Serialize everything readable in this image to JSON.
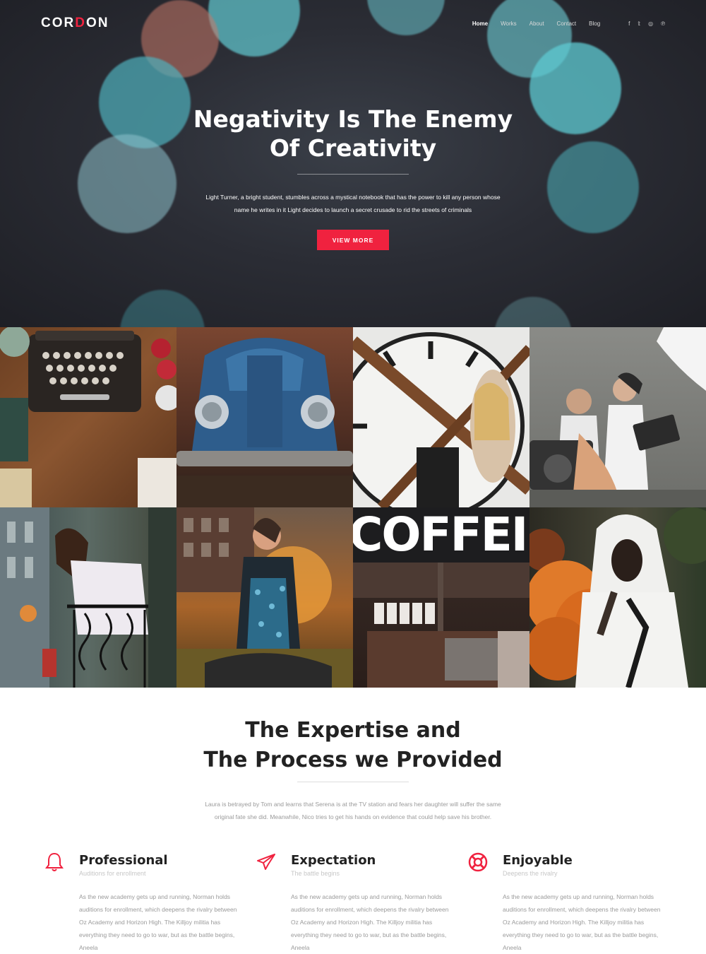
{
  "header": {
    "logo_left": "COR",
    "logo_mid": "D",
    "logo_right": "ON",
    "menu": [
      "Home",
      "Works",
      "About",
      "Contact",
      "Blog"
    ],
    "social": [
      "f",
      "𝕥",
      "◎",
      "℗"
    ]
  },
  "hero": {
    "title_line1": "Negativity Is The Enemy",
    "title_line2": "Of Creativity",
    "text": "Light Turner, a bright student, stumbles across a mystical notebook that has the power to kill any person whose name he writes in it Light decides to launch a secret crusade to rid the streets of criminals",
    "button": "VIEW MORE"
  },
  "gallery": {
    "coffee_sign": "COFFEI"
  },
  "expertise": {
    "title_line1": "The Expertise and",
    "title_line2": "The Process we Provided",
    "text": "Laura is betrayed by Tom and learns that Serena is at the TV station and fears her daughter will suffer the same original fate she did. Meanwhile, Nico tries to get his hands on evidence that could help save his brother.",
    "features": [
      {
        "icon": "bell-icon",
        "title": "Professional",
        "subtitle": "Auditions for enrollment",
        "body": "As the new academy gets up and running, Norman holds auditions for enrollment, which deepens the rivalry between Oz Academy and Horizon High. The Killjoy militia has everything they need to go to war, but as the battle begins, Aneela"
      },
      {
        "icon": "paper-plane-icon",
        "title": "Expectation",
        "subtitle": "The battle begins",
        "body": "As the new academy gets up and running, Norman holds auditions for enrollment, which deepens the rivalry between Oz Academy and Horizon High. The Killjoy militia has everything they need to go to war, but as the battle begins, Aneela"
      },
      {
        "icon": "life-ring-icon",
        "title": "Enjoyable",
        "subtitle": "Deepens the rivalry",
        "body": "As the new academy gets up and running, Norman holds auditions for enrollment, which deepens the rivalry between Oz Academy and Horizon High. The Killjoy militia has everything they need to go to war, but as the battle begins, Aneela"
      }
    ]
  },
  "colors": {
    "accent": "#f0223f",
    "dark": "#222222"
  }
}
